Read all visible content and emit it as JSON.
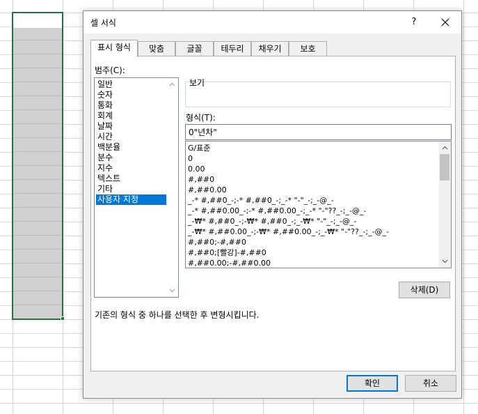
{
  "dialog": {
    "title": "셀 서식",
    "help": "?",
    "tabs": [
      "표시 형식",
      "맞춤",
      "글꼴",
      "테두리",
      "채우기",
      "보호"
    ],
    "active_tab": "표시 형식"
  },
  "category": {
    "label": "범주(C):",
    "items": [
      "일반",
      "숫자",
      "통화",
      "회계",
      "날짜",
      "시간",
      "백분율",
      "분수",
      "지수",
      "텍스트",
      "기타",
      "사용자 지정"
    ],
    "selected": "사용자 지정"
  },
  "sample": {
    "label": "보기"
  },
  "format_type": {
    "label": "형식(T):",
    "value": "0\"년차\"",
    "items": [
      "G/표준",
      "0",
      "0.00",
      "#,##0",
      "#,##0.00",
      "_-* #,##0_-;-* #,##0_-;_-* \"-\"_-;_-@_-",
      "_-* #,##0.00_-;-* #,##0.00_-;_-* \"-\"??_-;_-@_-",
      "_-₩* #,##0_-;-₩* #,##0_-;_-₩* \"-\"_-;_-@_-",
      "_-₩* #,##0.00_-;-₩* #,##0.00_-;_-₩* \"-\"??_-;_-@_-",
      "#,##0;-#,##0",
      "#,##0;[빨강]-#,##0",
      "#,##0.00;-#,##0.00"
    ]
  },
  "buttons": {
    "delete": "삭제(D)",
    "ok": "확인",
    "cancel": "취소"
  },
  "description": "기존의 형식 중 하나를 선택한 후 변형시킵니다.",
  "colors": {
    "accent": "#0078d7",
    "selection_border": "#217346"
  }
}
